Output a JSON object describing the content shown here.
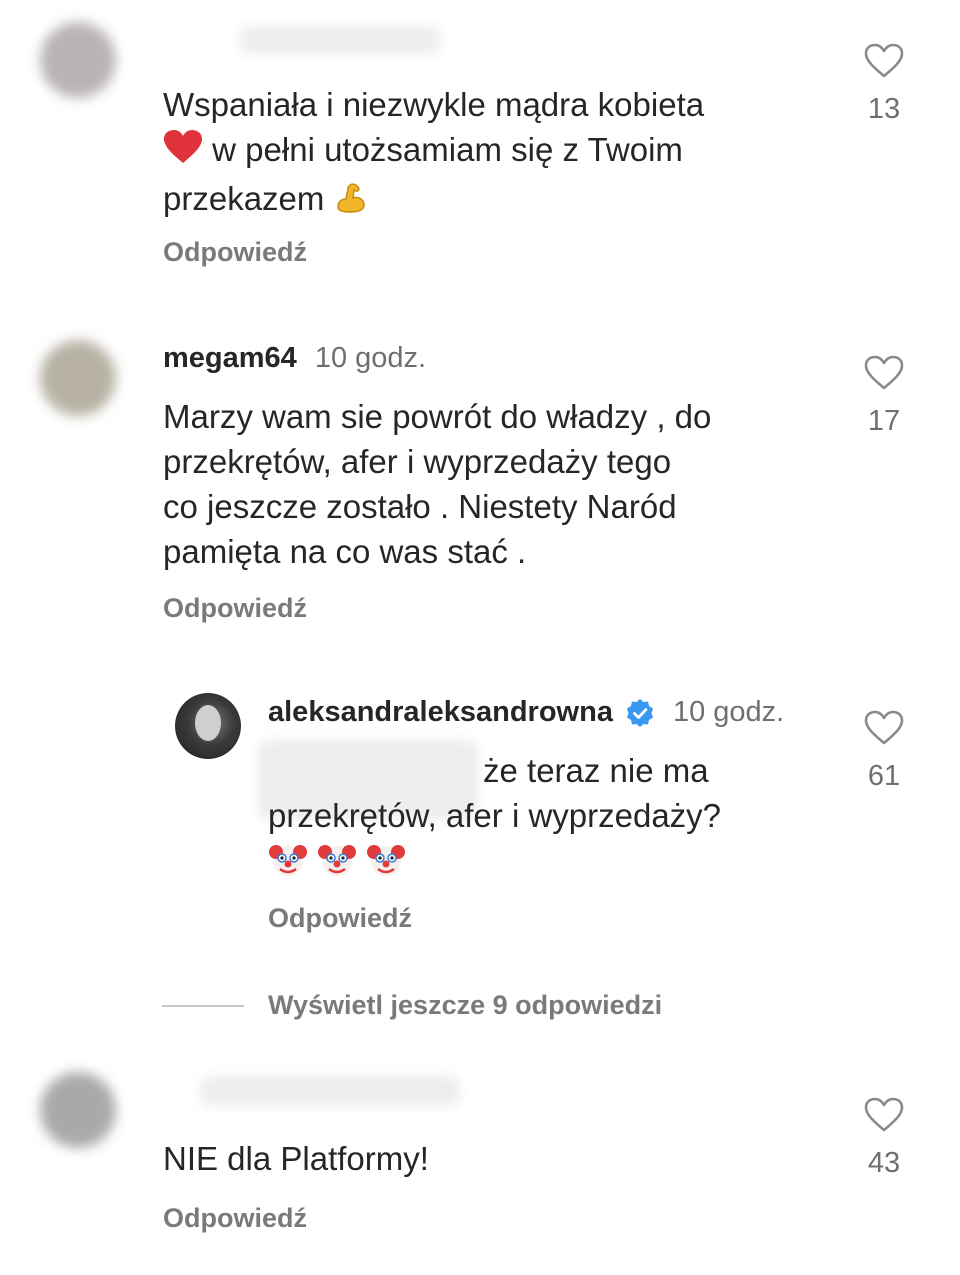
{
  "comments": [
    {
      "username": "",
      "time": "",
      "text_lines": [
        "Wspaniała i niezwykle mądra kobieta",
        "w pełni utożsamiam się z Twoim",
        "przekazem"
      ],
      "reply_label": "Odpowiedź",
      "likes": "13"
    },
    {
      "username": "megam64",
      "time": "10 godz.",
      "text_lines": [
        "Marzy wam sie powrót do władzy , do",
        "przekrętów, afer i wyprzedaży tego",
        "co jeszcze zostało . Niestety Naród",
        "pamięta na co was stać ."
      ],
      "reply_label": "Odpowiedź",
      "likes": "17"
    },
    {
      "username": "aleksandraleksandrowna",
      "time": "10 godz.",
      "text_lines": [
        "że teraz nie ma",
        "przekrętów, afer i wyprzedaży?"
      ],
      "reply_label": "Odpowiedź",
      "likes": "61",
      "verified": true
    },
    {
      "username": "",
      "time": "",
      "text_lines": [
        "NIE dla Platformy!"
      ],
      "reply_label": "Odpowiedź",
      "likes": "43"
    }
  ],
  "view_more_replies": "Wyświetl jeszcze 9 odpowiedzi",
  "icons": {
    "like": "heart-outline-icon",
    "verified": "verified-badge-icon",
    "emoji_heart": "red-heart-emoji",
    "emoji_muscle": "flexed-biceps-emoji",
    "emoji_clown": "clown-face-emoji"
  },
  "colors": {
    "text": "#262626",
    "secondary": "#7a7a7a",
    "verified": "#3897f0",
    "heart_emoji": "#e0323c"
  }
}
